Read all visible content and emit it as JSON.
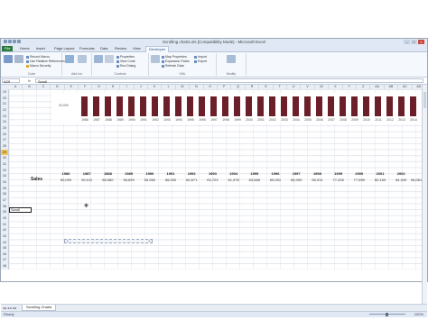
{
  "window": {
    "title": "Scrolling charts.xls [Compatibility Mode] - Microsoft Excel"
  },
  "tabs": [
    "File",
    "Home",
    "Insert",
    "Page Layout",
    "Formulas",
    "Data",
    "Review",
    "View",
    "Developer"
  ],
  "active_tab": "Developer",
  "ribbon": {
    "code": {
      "label": "Code",
      "visual_basic": "Visual Basic",
      "macros": "Macros",
      "record_macro": "Record Macro",
      "relative": "Use Relative References",
      "security": "Macro Security"
    },
    "add_ins": {
      "label": "Add-Ins",
      "add_ins": "Add-Ins",
      "com": "COM Add-Ins"
    },
    "controls": {
      "label": "Controls",
      "insert": "Insert",
      "design_mode": "Design Mode",
      "properties": "Properties",
      "view_code": "View Code",
      "run_dialog": "Run Dialog"
    },
    "xml": {
      "label": "XML",
      "source": "Source",
      "map_properties": "Map Properties",
      "expansion_packs": "Expansion Packs",
      "refresh_data": "Refresh Data",
      "import": "Import",
      "export": "Export"
    },
    "modify": {
      "label": "Modify",
      "document_panel": "Document Panel"
    }
  },
  "formula_bar": {
    "name_box": "A29",
    "fx": "fx",
    "content": "Scroll"
  },
  "columns": [
    "A",
    "B",
    "C",
    "D",
    "E",
    "F",
    "G",
    "H",
    "I",
    "J",
    "K",
    "L",
    "M",
    "N",
    "O",
    "P",
    "Q",
    "R",
    "S",
    "T",
    "U",
    "V",
    "W",
    "X",
    "Y",
    "Z",
    "AA",
    "AB",
    "AC",
    "AD"
  ],
  "rows": [
    "19",
    "20",
    "21",
    "22",
    "23",
    "24",
    "25",
    "26",
    "27",
    "28",
    "29",
    "30",
    "31",
    "32",
    "33",
    "34",
    "35",
    "36",
    "37",
    "38",
    "39",
    "40",
    "41",
    "42",
    "43",
    "44",
    "45",
    "46",
    "47",
    "48"
  ],
  "selected_row": "29",
  "chart_data": {
    "type": "bar",
    "categories": [
      "1986",
      "1987",
      "1988",
      "1989",
      "1990",
      "1991",
      "1992",
      "1993",
      "1994",
      "1995",
      "1996",
      "1997",
      "1998",
      "1999",
      "2000",
      "2001",
      "2002",
      "2003",
      "2004",
      "2005",
      "2006",
      "2007",
      "2008",
      "2009",
      "2010",
      "2011",
      "2012",
      "2013",
      "2014"
    ],
    "axis_label": "20,000",
    "title": "",
    "xlabel": "",
    "ylabel": "",
    "color": "#6b2029",
    "values_note_source": "cells"
  },
  "table": {
    "row_label": "Sales",
    "years": [
      "1986",
      "1987",
      "1988",
      "1989",
      "1990",
      "1991",
      "1992",
      "1993",
      "1994",
      "1995",
      "1996",
      "1997",
      "1998",
      "1999",
      "2000",
      "2001",
      "2002"
    ],
    "values": [
      "50,000",
      "50,011",
      "58,960",
      "55,699",
      "55,065",
      "56,090",
      "60,671",
      "63,723",
      "61,978",
      "63,668",
      "65,051",
      "65,000",
      "65,911",
      "77,228",
      "77,699",
      "82,169",
      "84,949",
      "96,061"
    ]
  },
  "active_cell_value": "Scroll",
  "sheet_tab": "Scrolling Charts",
  "status": {
    "ready": "Ready",
    "zoom": "100%"
  }
}
